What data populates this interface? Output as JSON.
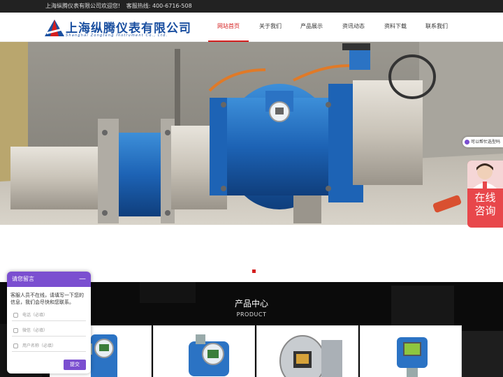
{
  "topbar": {
    "welcome": "上海纵腾仪表有限公司欢迎您!",
    "hotline": "客服热线: 400-6716-508"
  },
  "logo": {
    "name": "上海纵腾仪表有限公司",
    "english": "Shanghai Zongteng Instrument Co., Ltd."
  },
  "nav": {
    "items": [
      {
        "label": "网站首页"
      },
      {
        "label": "关于我们"
      },
      {
        "label": "产品展示"
      },
      {
        "label": "资讯动态"
      },
      {
        "label": "资料下载"
      },
      {
        "label": "联系我们"
      }
    ]
  },
  "products": {
    "title": "产品中心",
    "subtitle": "PRODUCT"
  },
  "chat": {
    "title": "请您留言",
    "minimize": "—",
    "message": "客服人员不在线，请填写一下您的信息，我们会尽快和您联系。",
    "fields": [
      {
        "placeholder": "电话（必填）"
      },
      {
        "placeholder": "微信（必填）"
      },
      {
        "placeholder": "用户名称（必填）"
      }
    ],
    "submit": "提交"
  },
  "side": {
    "tip": "可以帮忙选型吗",
    "online": "在线咨询"
  },
  "colors": {
    "accent": "#d41e1e",
    "chat": "#7b4fd0",
    "brand": "#1a4fa0"
  }
}
